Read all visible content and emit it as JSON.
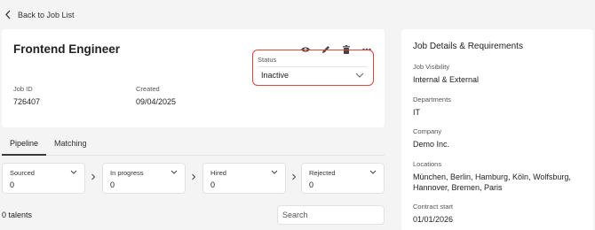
{
  "nav": {
    "back_label": "Back to Job List"
  },
  "job": {
    "title": "Frontend Engineer",
    "id_label": "Job ID",
    "id_value": "726407",
    "created_label": "Created",
    "created_value": "09/04/2025",
    "status_label": "Status",
    "status_value": "Inactive"
  },
  "actions": {
    "icons": [
      "eye-icon",
      "pencil-icon",
      "trash-icon",
      "more-icon"
    ]
  },
  "tabs": [
    {
      "label": "Pipeline",
      "active": true
    },
    {
      "label": "Matching",
      "active": false
    }
  ],
  "pipeline": [
    {
      "label": "Sourced",
      "count": "0"
    },
    {
      "label": "In progress",
      "count": "0"
    },
    {
      "label": "Hired",
      "count": "0"
    },
    {
      "label": "Rejected",
      "count": "0"
    }
  ],
  "talents": {
    "count_text": "0 talents",
    "search_placeholder": "Search"
  },
  "details": {
    "title": "Job Details & Requirements",
    "items": [
      {
        "label": "Job Visibility",
        "value": "Internal & External"
      },
      {
        "label": "Departments",
        "value": "IT"
      },
      {
        "label": "Company",
        "value": "Demo Inc."
      },
      {
        "label": "Locations",
        "value": "München, Berlin, Hamburg, Köln, Wolfsburg, Hannover, Bremen, Paris"
      },
      {
        "label": "Contract start",
        "value": "01/01/2026"
      }
    ]
  },
  "colors": {
    "highlight": "#e0463c",
    "background": "#f4f4f5",
    "card": "#ffffff"
  }
}
